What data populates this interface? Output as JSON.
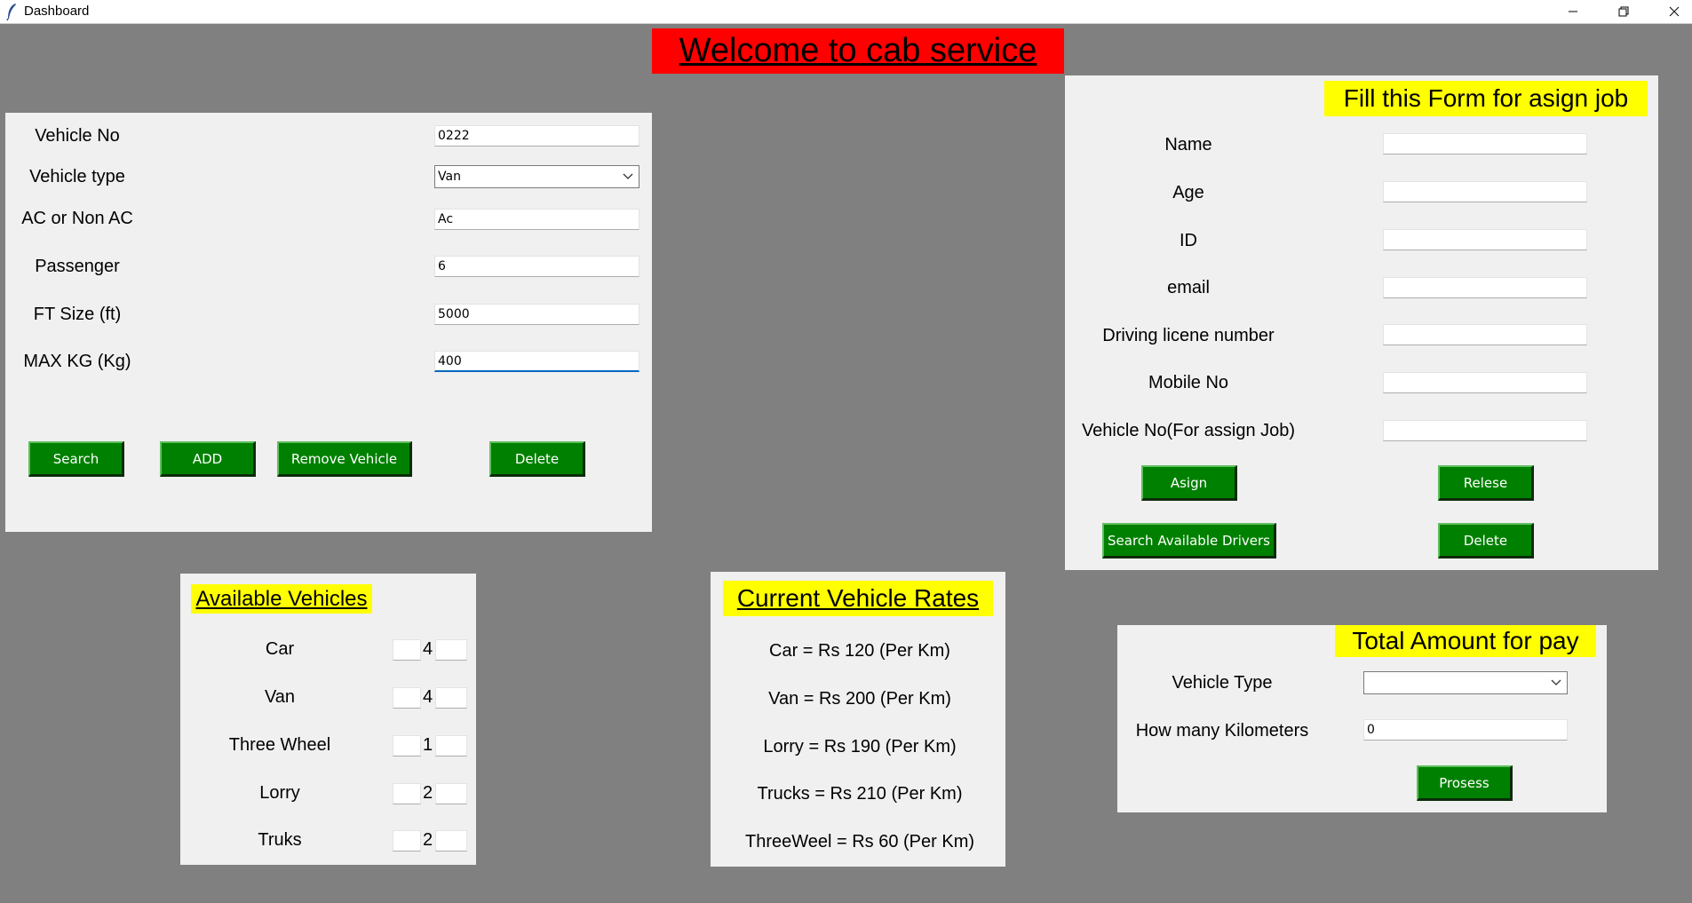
{
  "window": {
    "title": "Dashboard"
  },
  "heading": "Welcome to cab service",
  "vehicle_form": {
    "fields": [
      {
        "label": "Vehicle No",
        "value": "0222"
      },
      {
        "label": "Vehicle type",
        "value": "Van"
      },
      {
        "label": "AC or Non AC",
        "value": "Ac"
      },
      {
        "label": "Passenger",
        "value": "6"
      },
      {
        "label": "FT Size (ft)",
        "value": "5000"
      },
      {
        "label": "MAX KG (Kg)",
        "value": "400"
      }
    ],
    "buttons": {
      "search": "Search",
      "add": "ADD",
      "remove": "Remove Vehicle",
      "delete": "Delete"
    }
  },
  "job_form": {
    "title": "Fill this Form for asign job",
    "fields": [
      {
        "label": "Name",
        "value": ""
      },
      {
        "label": "Age",
        "value": ""
      },
      {
        "label": "ID",
        "value": ""
      },
      {
        "label": "email",
        "value": ""
      },
      {
        "label": "Driving licene number",
        "value": ""
      },
      {
        "label": "Mobile No",
        "value": ""
      },
      {
        "label": "Vehicle No(For assign Job)",
        "value": ""
      }
    ],
    "buttons": {
      "asign": "Asign",
      "relese": "Relese",
      "search_drivers": "Search Available Drivers",
      "delete": "Delete"
    }
  },
  "available_vehicles": {
    "title": "Available Vehicles",
    "items": [
      {
        "name": "Car",
        "count": "4"
      },
      {
        "name": "Van",
        "count": "4"
      },
      {
        "name": "Three Wheel",
        "count": "1"
      },
      {
        "name": "Lorry",
        "count": "2"
      },
      {
        "name": "Truks",
        "count": "2"
      }
    ]
  },
  "rates": {
    "title": "Current Vehicle Rates",
    "items": [
      "Car = Rs 120 (Per Km)",
      "Van = Rs 200 (Per Km)",
      "Lorry = Rs 190 (Per Km)",
      "Trucks = Rs 210 (Per Km)",
      "ThreeWeel = Rs 60 (Per Km)"
    ]
  },
  "total": {
    "title": "Total Amount for pay",
    "vehicle_type_label": "Vehicle Type",
    "vehicle_type_value": "",
    "km_label": "How many Kilometers",
    "km_value": "0",
    "process_button": "Prosess"
  }
}
